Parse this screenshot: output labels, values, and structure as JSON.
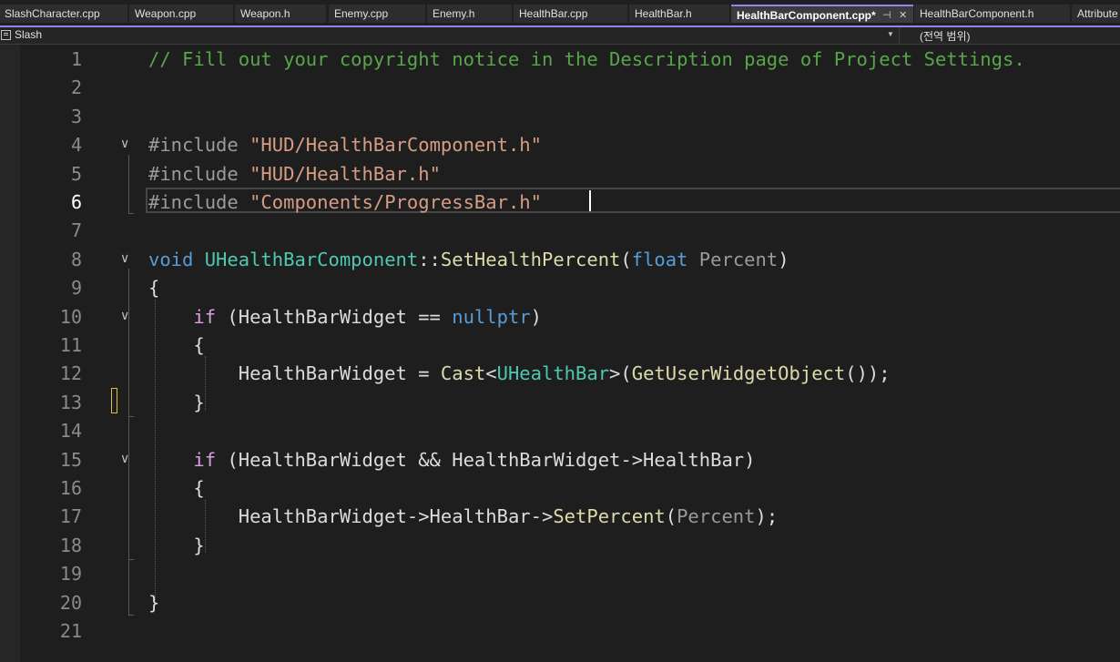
{
  "tabs": [
    {
      "label": "SlashCharacter.cpp"
    },
    {
      "label": "Weapon.cpp"
    },
    {
      "label": "Weapon.h"
    },
    {
      "label": "Enemy.cpp"
    },
    {
      "label": "Enemy.h"
    },
    {
      "label": "HealthBar.cpp"
    },
    {
      "label": "HealthBar.h"
    },
    {
      "label": "HealthBarComponent.cpp*",
      "active": true
    },
    {
      "label": "HealthBarComponent.h"
    },
    {
      "label": "Attribute"
    }
  ],
  "tab_icons": {
    "pin": "pin-icon",
    "close": "close-icon"
  },
  "nav": {
    "project": "Slash",
    "scope": "(전역 범위)"
  },
  "editor": {
    "current_line": 6,
    "accent_color": "#9184ee",
    "lines": [
      {
        "n": "1",
        "tokens": [
          {
            "t": "// Fill out your copyright notice in the Description page of Project Settings.",
            "c": "comment"
          }
        ]
      },
      {
        "n": "2",
        "tokens": []
      },
      {
        "n": "3",
        "tokens": []
      },
      {
        "n": "4",
        "fold": true,
        "tokens": [
          {
            "t": "#include ",
            "c": "pp"
          },
          {
            "t": "\"HUD/HealthBarComponent.h\"",
            "c": "string"
          }
        ]
      },
      {
        "n": "5",
        "tokens": [
          {
            "t": "#include ",
            "c": "pp"
          },
          {
            "t": "\"HUD/HealthBar.h\"",
            "c": "string"
          }
        ]
      },
      {
        "n": "6",
        "tokens": [
          {
            "t": "#include ",
            "c": "pp"
          },
          {
            "t": "\"Components/ProgressBar.h\"",
            "c": "string"
          }
        ]
      },
      {
        "n": "7",
        "tokens": []
      },
      {
        "n": "8",
        "fold": true,
        "tokens": [
          {
            "t": "void ",
            "c": "keyword"
          },
          {
            "t": "UHealthBarComponent",
            "c": "type"
          },
          {
            "t": "::",
            "c": "plain"
          },
          {
            "t": "SetHealthPercent",
            "c": "func"
          },
          {
            "t": "(",
            "c": "plain"
          },
          {
            "t": "float ",
            "c": "keyword"
          },
          {
            "t": "Percent",
            "c": "param"
          },
          {
            "t": ")",
            "c": "plain"
          }
        ]
      },
      {
        "n": "9",
        "tokens": [
          {
            "t": "{",
            "c": "plain"
          }
        ]
      },
      {
        "n": "10",
        "fold": true,
        "tokens": [
          {
            "t": "    ",
            "c": "plain"
          },
          {
            "t": "if",
            "c": "ctrl"
          },
          {
            "t": " (HealthBarWidget == ",
            "c": "plain"
          },
          {
            "t": "nullptr",
            "c": "keyword"
          },
          {
            "t": ")",
            "c": "plain"
          }
        ]
      },
      {
        "n": "11",
        "tokens": [
          {
            "t": "    {",
            "c": "plain"
          }
        ]
      },
      {
        "n": "12",
        "tokens": [
          {
            "t": "        HealthBarWidget = ",
            "c": "plain"
          },
          {
            "t": "Cast",
            "c": "func"
          },
          {
            "t": "<",
            "c": "plain"
          },
          {
            "t": "UHealthBar",
            "c": "type"
          },
          {
            "t": ">(",
            "c": "plain"
          },
          {
            "t": "GetUserWidgetObject",
            "c": "func"
          },
          {
            "t": "());",
            "c": "plain"
          }
        ]
      },
      {
        "n": "13",
        "tokens": [
          {
            "t": "    }",
            "c": "plain"
          }
        ]
      },
      {
        "n": "14",
        "tokens": []
      },
      {
        "n": "15",
        "fold": true,
        "tokens": [
          {
            "t": "    ",
            "c": "plain"
          },
          {
            "t": "if",
            "c": "ctrl"
          },
          {
            "t": " (HealthBarWidget && HealthBarWidget->HealthBar)",
            "c": "plain"
          }
        ]
      },
      {
        "n": "16",
        "tokens": [
          {
            "t": "    {",
            "c": "plain"
          }
        ]
      },
      {
        "n": "17",
        "tokens": [
          {
            "t": "        HealthBarWidget->HealthBar->",
            "c": "plain"
          },
          {
            "t": "SetPercent",
            "c": "func"
          },
          {
            "t": "(",
            "c": "plain"
          },
          {
            "t": "Percent",
            "c": "param"
          },
          {
            "t": ");",
            "c": "plain"
          }
        ]
      },
      {
        "n": "18",
        "tokens": [
          {
            "t": "    }",
            "c": "plain"
          }
        ]
      },
      {
        "n": "19",
        "tokens": []
      },
      {
        "n": "20",
        "tokens": [
          {
            "t": "}",
            "c": "plain"
          }
        ]
      },
      {
        "n": "21",
        "tokens": []
      }
    ]
  }
}
